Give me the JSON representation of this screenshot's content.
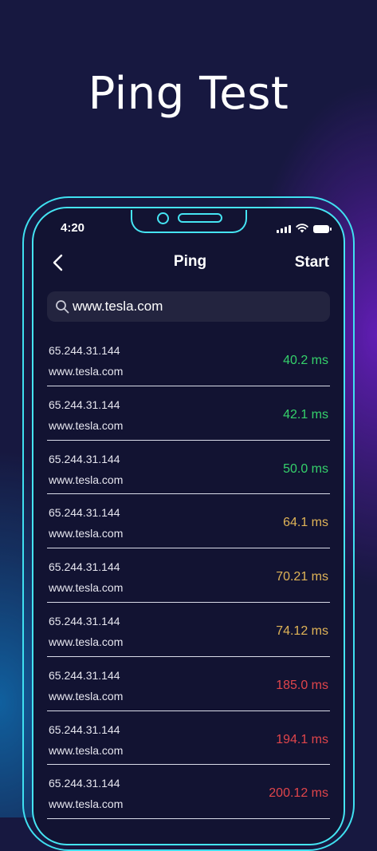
{
  "headline": "Ping Test",
  "status_bar": {
    "time": "4:20"
  },
  "nav": {
    "title": "Ping",
    "action": "Start"
  },
  "search": {
    "value": "www.tesla.com"
  },
  "colors": {
    "frame": "#45e4f3",
    "good": "#35d16b",
    "medium": "#e0b457",
    "bad": "#e0454b"
  },
  "results": [
    {
      "ip": "65.244.31.144",
      "host": "www.tesla.com",
      "time": "40.2 ms",
      "level": "good"
    },
    {
      "ip": "65.244.31.144",
      "host": "www.tesla.com",
      "time": "42.1 ms",
      "level": "good"
    },
    {
      "ip": "65.244.31.144",
      "host": "www.tesla.com",
      "time": "50.0 ms",
      "level": "good"
    },
    {
      "ip": "65.244.31.144",
      "host": "www.tesla.com",
      "time": "64.1 ms",
      "level": "medium"
    },
    {
      "ip": "65.244.31.144",
      "host": "www.tesla.com",
      "time": "70.21 ms",
      "level": "medium"
    },
    {
      "ip": "65.244.31.144",
      "host": "www.tesla.com",
      "time": "74.12 ms",
      "level": "medium"
    },
    {
      "ip": "65.244.31.144",
      "host": "www.tesla.com",
      "time": "185.0 ms",
      "level": "bad"
    },
    {
      "ip": "65.244.31.144",
      "host": "www.tesla.com",
      "time": "194.1 ms",
      "level": "bad"
    },
    {
      "ip": "65.244.31.144",
      "host": "www.tesla.com",
      "time": "200.12 ms",
      "level": "bad"
    }
  ]
}
